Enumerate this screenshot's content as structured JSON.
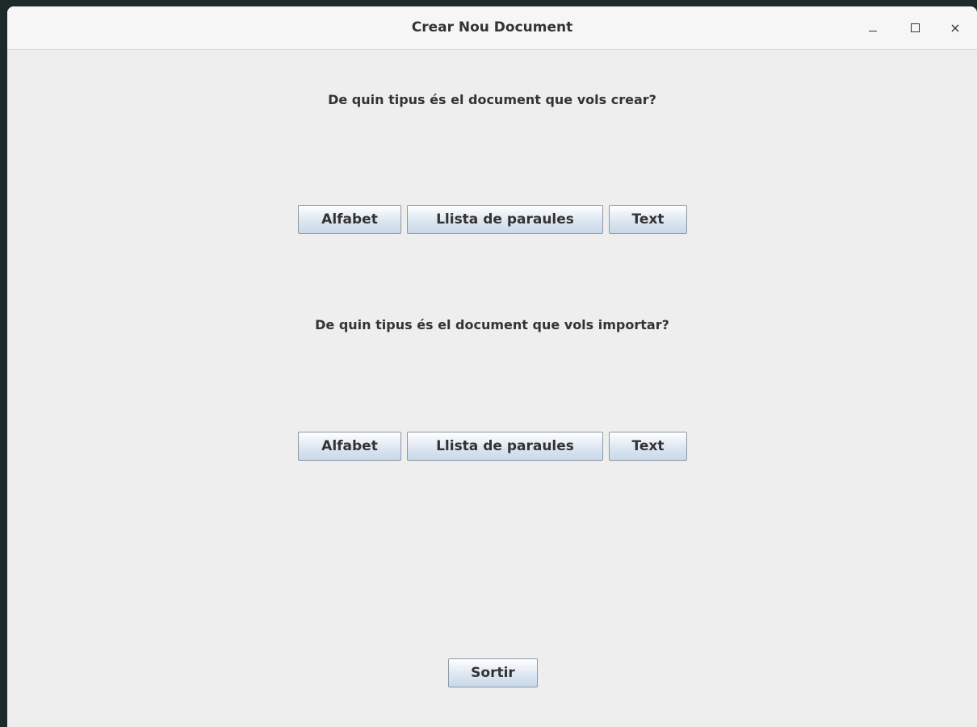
{
  "window": {
    "title": "Crear Nou Document",
    "controls": {
      "minimize": "–",
      "maximize": "□",
      "close": "×"
    }
  },
  "create_section": {
    "question": "De quin tipus és el document que vols crear?",
    "buttons": [
      "Alfabet",
      "Llista de paraules",
      "Text"
    ]
  },
  "import_section": {
    "question": "De quin tipus és el document que vols importar?",
    "buttons": [
      "Alfabet",
      "Llista de paraules",
      "Text"
    ]
  },
  "footer": {
    "exit_label": "Sortir"
  },
  "colors": {
    "window_bg": "#eeeeee",
    "titlebar_bg": "#f6f6f6",
    "button_gradient_top": "#ffffff",
    "button_gradient_bottom": "#c9d8e8",
    "button_border": "#8e99a6",
    "text": "#333333"
  }
}
